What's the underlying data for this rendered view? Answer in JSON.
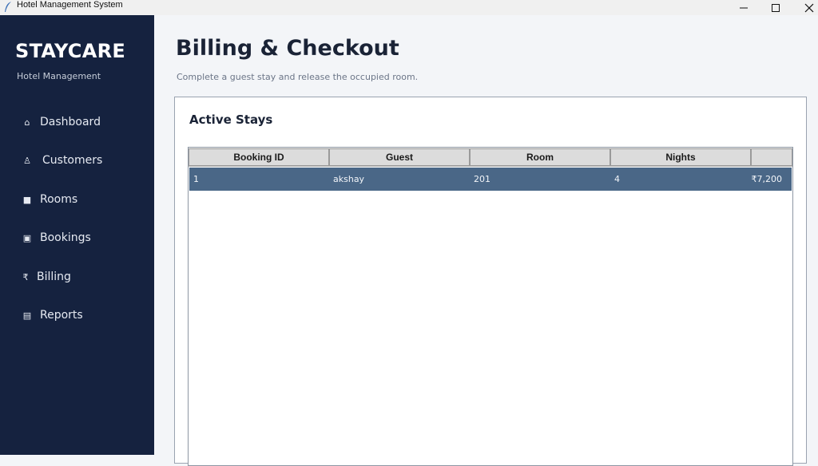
{
  "window": {
    "title": "Hotel Management System",
    "controls": {
      "minimize": "—",
      "maximize": "☐",
      "close": "✕"
    }
  },
  "sidebar": {
    "brand": "STAYCARE",
    "subtitle": "Hotel Management",
    "items": [
      {
        "icon": "⌂",
        "icon_name": "home-icon",
        "label": "Dashboard"
      },
      {
        "icon": "♙",
        "icon_name": "user-icon",
        "label": "Customers"
      },
      {
        "icon": "■",
        "icon_name": "square-icon",
        "label": "Rooms"
      },
      {
        "icon": "▣",
        "icon_name": "calendar-icon",
        "label": "Bookings"
      },
      {
        "icon": "₹",
        "icon_name": "rupee-icon",
        "label": "Billing"
      },
      {
        "icon": "▤",
        "icon_name": "report-icon",
        "label": "Reports"
      }
    ]
  },
  "main": {
    "title": "Billing & Checkout",
    "subtitle": "Complete a guest stay and release the occupied room."
  },
  "active_stays": {
    "title": "Active Stays",
    "columns": [
      "Booking ID",
      "Guest",
      "Room",
      "Nights",
      ""
    ],
    "rows": [
      {
        "booking_id": "1",
        "guest": "akshay",
        "room": "201",
        "nights": "4",
        "amount": "₹7,200",
        "selected": true
      }
    ]
  },
  "colors": {
    "sidebar_bg": "#15223f",
    "page_bg": "#f3f5f8",
    "selected_row": "#4a6787",
    "title_text": "#1a2336"
  }
}
